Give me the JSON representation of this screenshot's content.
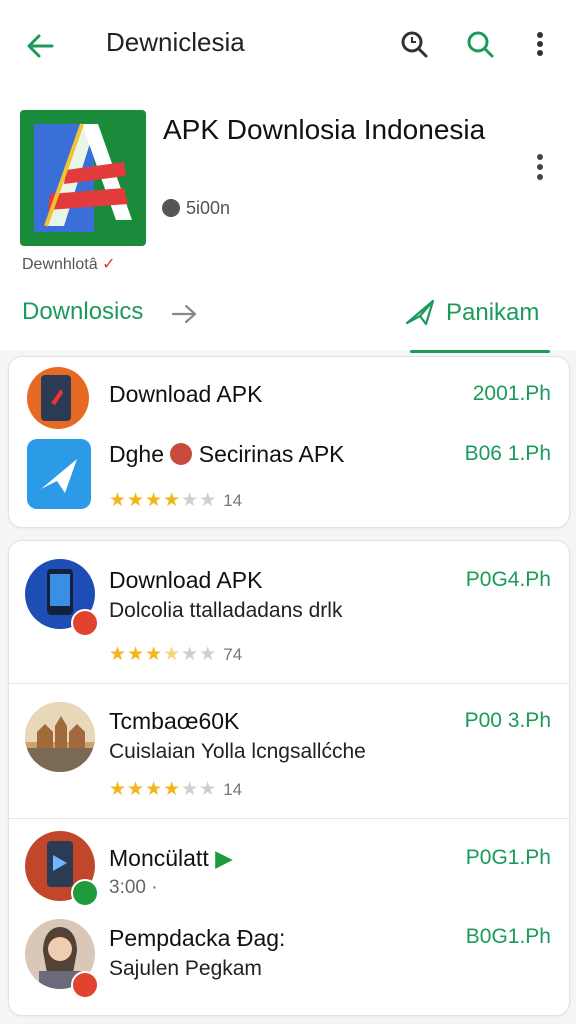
{
  "header": {
    "title": "Dewniclesia"
  },
  "app": {
    "name": "APK Downlosia Indonesia",
    "meta": "5i00n",
    "developer": "Dewnhlotâ"
  },
  "links": {
    "downloads": "Downlosics",
    "panikam": "Panikam"
  },
  "card1": [
    {
      "title": "Download APK",
      "price": "2001.Ph"
    },
    {
      "title": "Dghe",
      "title2": "Secirinas APK",
      "price": "B06 1.Ph",
      "stars": 4,
      "count": "14"
    }
  ],
  "card2": [
    {
      "title": "Download APK",
      "subtitle": "Dolcolia ttalladadans drlk",
      "price": "P0G4.Ph",
      "stars": 3.5,
      "count": "74"
    },
    {
      "title": "Tcmbaœ60K",
      "subtitle": "Cuislaian Yolla lcngsallćche",
      "price": "P00 3.Ph",
      "stars": 4,
      "count": "14"
    },
    {
      "title": "Moncülatt",
      "subtitle": "3:00 ·",
      "price": "P0G1.Ph"
    },
    {
      "title": "Pempdacka Ðag:",
      "subtitle": "Sajulen Pegkam",
      "price": "B0G1.Ph"
    }
  ],
  "colors": {
    "accent": "#1a9b5a",
    "star": "#f2b51a",
    "badge_red": "#e2432f",
    "badge_green": "#1f9a3c"
  }
}
